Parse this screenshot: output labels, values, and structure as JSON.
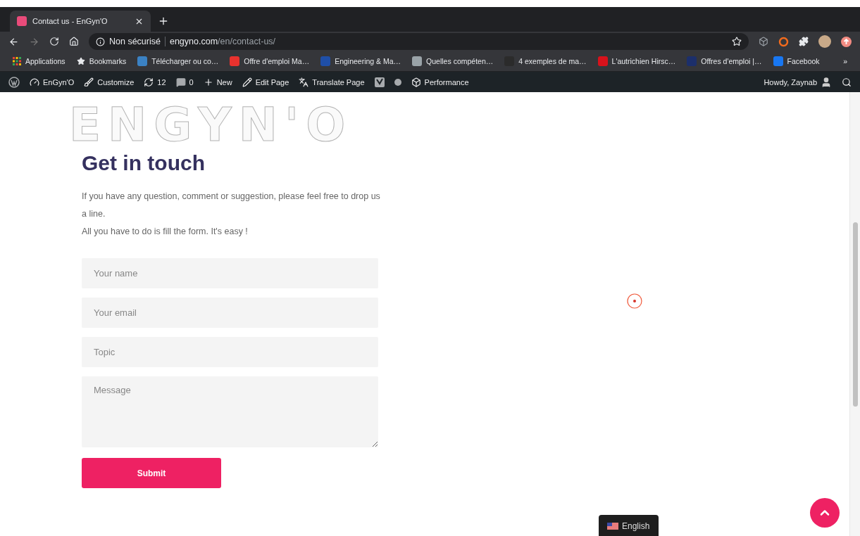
{
  "browser": {
    "tabs": [
      {
        "title": "Contact us - EnGyn'O",
        "selected": true
      }
    ],
    "address": {
      "security": "Non sécurisé",
      "domain": "engyno.com",
      "path": "/en/contact-us/"
    },
    "bookmarks": [
      {
        "kind": "apps",
        "label": "Applications"
      },
      {
        "kind": "star",
        "label": "Bookmarks"
      },
      {
        "kind": "site",
        "label": "Télécharger ou co…",
        "color": "#3b82c4"
      },
      {
        "kind": "site",
        "label": "Offre d'emploi Ma…",
        "color": "#e8322e"
      },
      {
        "kind": "site",
        "label": "Engineering & Ma…",
        "color": "#1f4fa8"
      },
      {
        "kind": "site",
        "label": "Quelles compéten…",
        "color": "#9aa3a8"
      },
      {
        "kind": "site",
        "label": "4 exemples de ma…",
        "color": "#2b2b2b"
      },
      {
        "kind": "site",
        "label": "L'autrichien Hirsc…",
        "color": "#d8121b"
      },
      {
        "kind": "site",
        "label": "Offres d'emploi |…",
        "color": "#1c2f6b"
      },
      {
        "kind": "site",
        "label": "Facebook",
        "color": "#1877f2"
      }
    ],
    "more": "»"
  },
  "admin_bar": {
    "items": [
      {
        "kind": "wp"
      },
      {
        "kind": "site",
        "label": "EnGyn'O"
      },
      {
        "kind": "customize",
        "label": "Customize"
      },
      {
        "kind": "updates",
        "label": "12"
      },
      {
        "kind": "comments",
        "label": "0"
      },
      {
        "kind": "new",
        "label": "New"
      },
      {
        "kind": "edit",
        "label": "Edit Page"
      },
      {
        "kind": "translate",
        "label": "Translate Page"
      },
      {
        "kind": "seo"
      },
      {
        "kind": "dot"
      },
      {
        "kind": "performance",
        "label": "Performance"
      }
    ],
    "account": "Howdy, Zaynab"
  },
  "page": {
    "backdrop": "ENGYN'O",
    "heading": "Get in touch",
    "intro_lines": [
      "If you have any question, comment or suggestion, please feel free to drop us a line.",
      "All you have to do is fill the form. It's easy !"
    ],
    "fields": [
      {
        "kind": "text",
        "placeholder": "Your name"
      },
      {
        "kind": "text",
        "placeholder": "Your email"
      },
      {
        "kind": "text",
        "placeholder": "Topic"
      },
      {
        "kind": "textarea",
        "placeholder": "Message"
      }
    ],
    "submit": "Submit"
  },
  "language": "English"
}
